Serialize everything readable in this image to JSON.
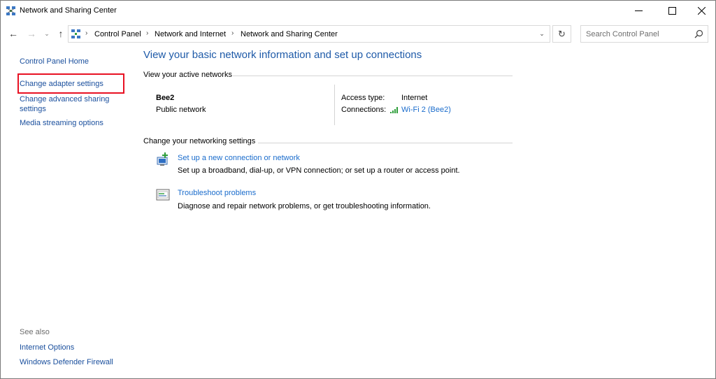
{
  "window": {
    "title": "Network and Sharing Center",
    "icon": "network-center-icon"
  },
  "controls": {
    "minimize_icon": "minimize-icon",
    "maximize_icon": "maximize-icon",
    "close_icon": "close-icon"
  },
  "nav": {
    "back_glyph": "←",
    "forward_glyph": "→",
    "recent_glyph": "⌄",
    "up_glyph": "↑",
    "refresh_glyph": "↻",
    "dropdown_glyph": "⌄",
    "breadcrumbs": [
      "Control Panel",
      "Network and Internet",
      "Network and Sharing Center"
    ],
    "separator": "›"
  },
  "search": {
    "placeholder": "Search Control Panel"
  },
  "sidebar": {
    "home": "Control Panel Home",
    "items": [
      {
        "label": "Change adapter settings",
        "highlighted": true
      },
      {
        "label_line1": "Change advanced sharing",
        "label_line2": "settings"
      },
      {
        "label": "Media streaming options"
      }
    ],
    "see_also_heading": "See also",
    "see_also": [
      {
        "label": "Internet Options"
      },
      {
        "label": "Windows Defender Firewall"
      }
    ]
  },
  "main": {
    "title": "View your basic network information and set up connections",
    "active_networks_heading": "View your active networks",
    "network": {
      "name": "Bee2",
      "type": "Public network",
      "access_type_label": "Access type:",
      "access_type_value": "Internet",
      "connections_label": "Connections:",
      "connections_value": "Wi-Fi 2 (Bee2)"
    },
    "settings_heading": "Change your networking settings",
    "tasks": [
      {
        "link": "Set up a new connection or network",
        "description": "Set up a broadband, dial-up, or VPN connection; or set up a router or access point.",
        "icon": "new-connection-icon"
      },
      {
        "link": "Troubleshoot problems",
        "description": "Diagnose and repair network problems, or get troubleshooting information.",
        "icon": "troubleshoot-icon"
      }
    ]
  },
  "colors": {
    "link": "#1a4f9d",
    "link_blue": "#1a6ccc",
    "title_blue": "#1e5aa8",
    "highlight_red": "#e81123",
    "signal_green": "#2e9e3a"
  }
}
